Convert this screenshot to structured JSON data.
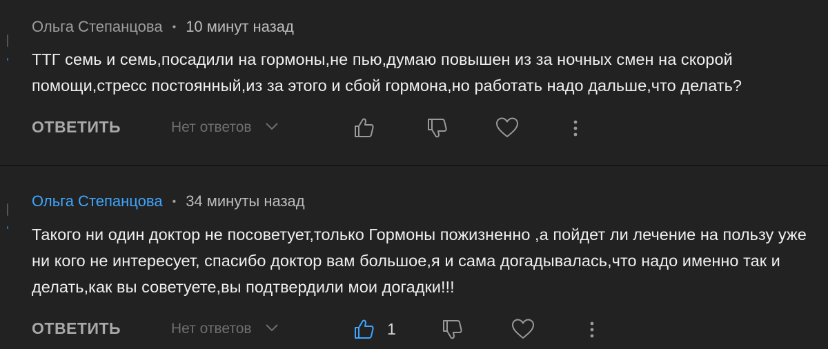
{
  "colors": {
    "background": "#222222",
    "divider": "#141414",
    "author_highlight": "#3ea6ff",
    "like_active": "#3ea6ff",
    "icon_idle": "#9a9a9a"
  },
  "comments": [
    {
      "author": "Ольга Степанцова",
      "separator": "•",
      "time": "10 минут назад",
      "text": "ТТГ семь и семь,посадили на гормоны,не пью,думаю повышен из за ночных смен на скорой помощи,стресс постоянный,из за этого и сбой гормона,но работать надо дальше,что делать?",
      "reply_label": "ОТВЕТИТЬ",
      "replies_label": "Нет ответов",
      "like_count": "",
      "liked": false,
      "icons": [
        "thumbs-up-icon",
        "thumbs-down-icon",
        "heart-icon",
        "more-vertical-icon"
      ]
    },
    {
      "author": "Ольга Степанцова",
      "separator": "•",
      "time": "34 минуты назад",
      "text": "Такого ни один доктор не посоветует,только Гормоны пожизненно ,а пойдет ли лечение на пользу уже ни кого не интересует, спасибо доктор вам большое,я и сама догадывалась,что надо именно так и делать,как вы советуете,вы подтвердили мои догадки!!!",
      "reply_label": "ОТВЕТИТЬ",
      "replies_label": "Нет ответов",
      "like_count": "1",
      "liked": true,
      "icons": [
        "thumbs-up-icon",
        "thumbs-down-icon",
        "heart-icon",
        "more-vertical-icon"
      ]
    }
  ]
}
